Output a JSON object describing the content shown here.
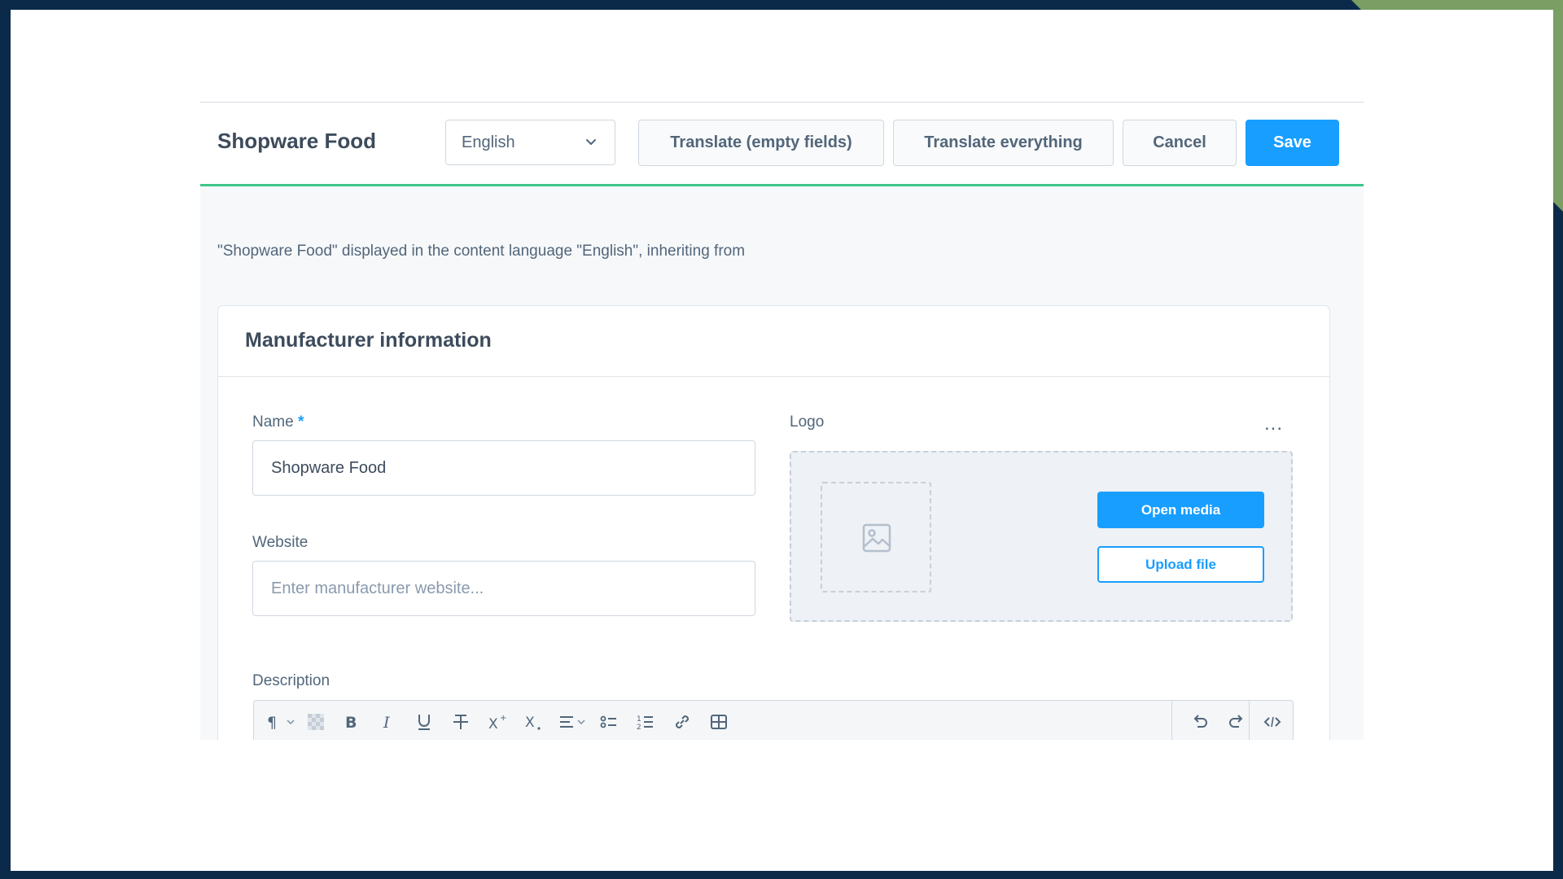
{
  "smart_bar": {
    "title": "Shopware Food",
    "language": "English",
    "translate_empty_label": "Translate (empty fields)",
    "translate_all_label": "Translate everything",
    "cancel_label": "Cancel",
    "save_label": "Save"
  },
  "info_text": "\"Shopware Food\" displayed in the content language \"English\", inheriting from",
  "card": {
    "title": "Manufacturer information",
    "name_label": "Name",
    "required_mark": "*",
    "name_value": "Shopware Food",
    "website_label": "Website",
    "website_placeholder": "Enter manufacturer website...",
    "logo_label": "Logo",
    "more_label": "...",
    "open_media_label": "Open media",
    "upload_file_label": "Upload file",
    "description_label": "Description"
  },
  "toolbar": {
    "icons": [
      "paragraph-icon",
      "clear-format-icon",
      "bold-icon",
      "italic-icon",
      "underline-icon",
      "strikethrough-icon",
      "superscript-icon",
      "subscript-icon",
      "align-icon",
      "bullet-list-icon",
      "numbered-list-icon",
      "link-icon",
      "table-icon",
      "undo-icon",
      "redo-icon",
      "code-view-icon"
    ]
  },
  "colors": {
    "accent": "#189eff",
    "header_border": "#3cc68a",
    "frame": "#0b2a49",
    "corner": "#7a9e63"
  }
}
